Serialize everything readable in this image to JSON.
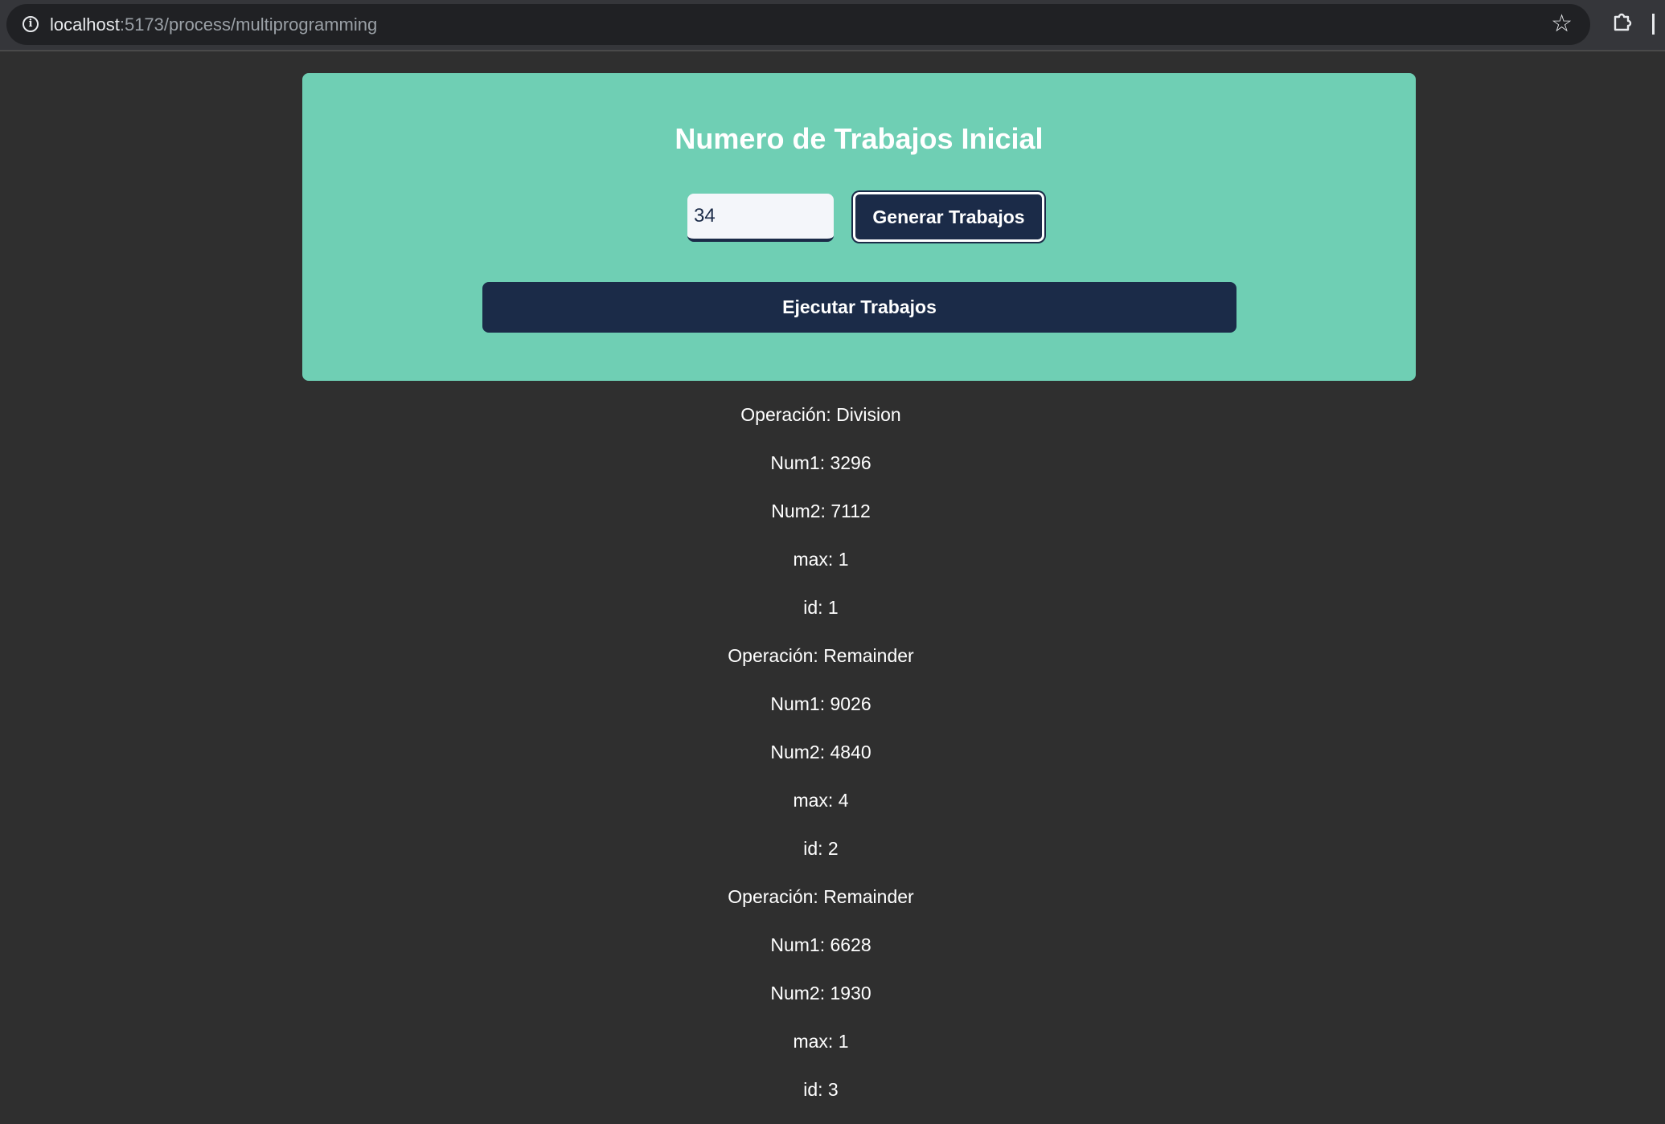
{
  "browser": {
    "url_host": "localhost",
    "url_path": ":5173/process/multiprogramming"
  },
  "panel": {
    "title": "Numero de Trabajos Inicial",
    "job_count_value": "34",
    "generate_label": "Generar Trabajos",
    "execute_label": "Ejecutar Trabajos"
  },
  "jobs": [
    {
      "operation": "Operación: Division",
      "num1": "Num1: 3296",
      "num2": "Num2: 7112",
      "max": "max: 1",
      "id": "id: 1"
    },
    {
      "operation": "Operación: Remainder",
      "num1": "Num1: 9026",
      "num2": "Num2: 4840",
      "max": "max: 4",
      "id": "id: 2"
    },
    {
      "operation": "Operación: Remainder",
      "num1": "Num1: 6628",
      "num2": "Num2: 1930",
      "max": "max: 1",
      "id": "id: 3"
    }
  ]
}
